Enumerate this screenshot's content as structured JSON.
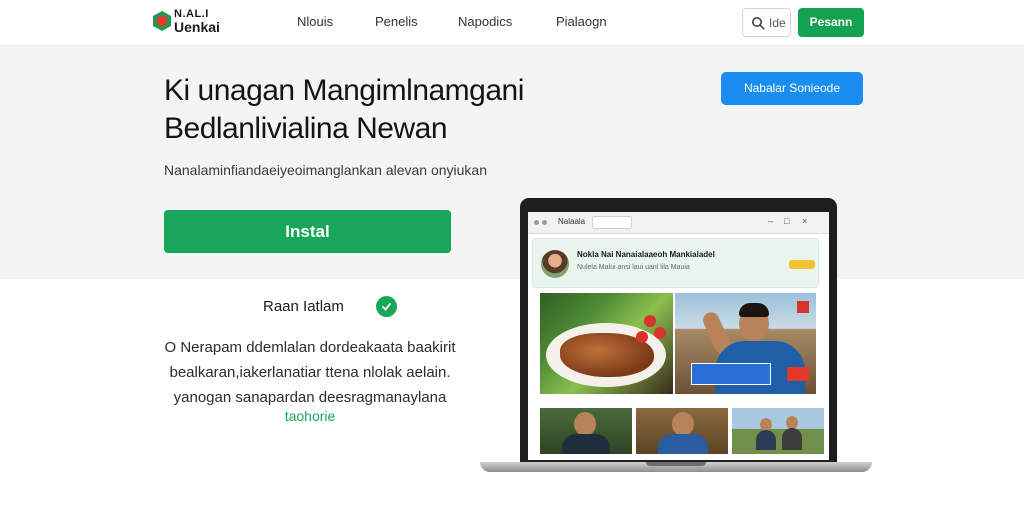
{
  "header": {
    "logo_top": "N.AL.I",
    "logo_bottom": "Uenkai",
    "nav": [
      "Nlouis",
      "Penelis",
      "Napodics",
      "Pialaogn"
    ],
    "search_label": "Ide",
    "cta_label": "Pesann"
  },
  "hero": {
    "title_line1": "Ki unagan Mangimlnamgani",
    "title_line2": "Bedlanlivialina Newan",
    "subtitle": "Nanalaminfiandaeiyeoimanglankan alevan onyiukan",
    "install_label": "Instal",
    "secondary_cta_label": "Nabalar Sonieode"
  },
  "feature": {
    "label": "Raan Iatlam",
    "desc_line1": "O Nerapam ddemlalan dordeakaata baakirit",
    "desc_line2": "bealkaran,iakerlanatiar ttena nlolak aelain.",
    "desc_line3": "yanogan sanapardan deesragmanaylana",
    "link": "taohorie"
  },
  "laptop": {
    "address_label": "Nalaala",
    "site_title": "Nokla Nai Nanaialaaeoh Mankialadel",
    "site_meta": "Nulela Malui ansi laui uanl lila Mauia"
  },
  "colors": {
    "green": "#17a65a",
    "blue": "#1a8ef0",
    "hero_bg": "#f4f4f5"
  }
}
